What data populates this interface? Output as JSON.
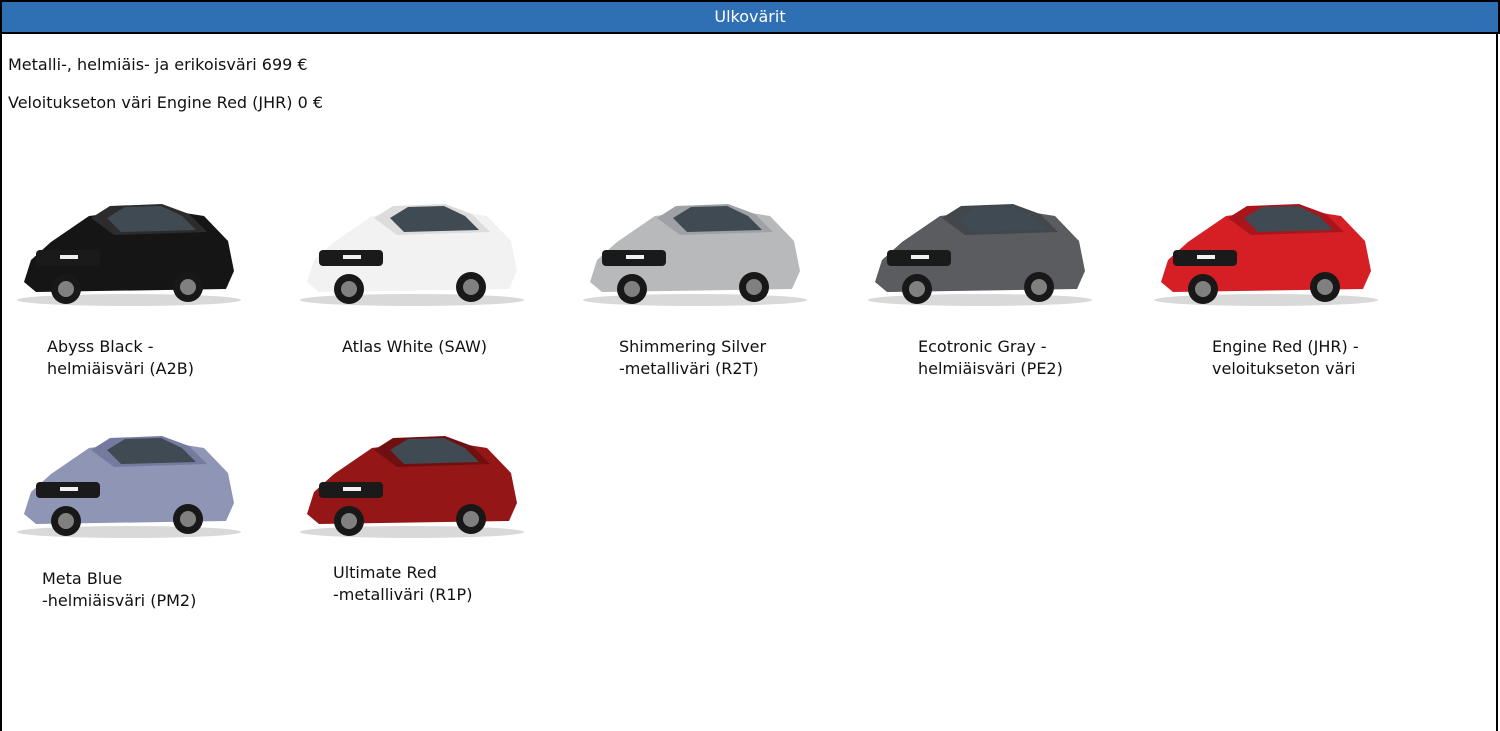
{
  "header": {
    "title": "Ulkovärit"
  },
  "pricing": [
    "Metalli-, helmiäis- ja erikoisväri 699 €",
    "Veloitukseton väri Engine Red (JHR) 0 €"
  ],
  "colors": [
    {
      "line1": "Abyss Black -",
      "line2": "helmiäisväri (A2B)",
      "paint": "#151515",
      "accent": "#2c2c2c"
    },
    {
      "line1": "Atlas White (SAW)",
      "line2": "",
      "paint": "#f2f2f2",
      "accent": "#dcdcdc"
    },
    {
      "line1": "Shimmering Silver",
      "line2": "-metalliväri (R2T)",
      "paint": "#b8b9bb",
      "accent": "#9fa1a4"
    },
    {
      "line1": "Ecotronic Gray -",
      "line2": "helmiäisväri (PE2)",
      "paint": "#5a5c5f",
      "accent": "#43464a"
    },
    {
      "line1": "Engine Red (JHR) -",
      "line2": "veloitukseton väri",
      "paint": "#d51f25",
      "accent": "#a9151b"
    },
    {
      "line1": "Meta Blue",
      "line2": "-helmiäisväri (PM2)",
      "paint": "#8f95b4",
      "accent": "#747b9f"
    },
    {
      "line1": "Ultimate Red",
      "line2": "-metalliväri (R1P)",
      "paint": "#941617",
      "accent": "#6f0f10"
    }
  ],
  "theme": {
    "header_blue": "#2f6fb4",
    "border": "#000000"
  }
}
